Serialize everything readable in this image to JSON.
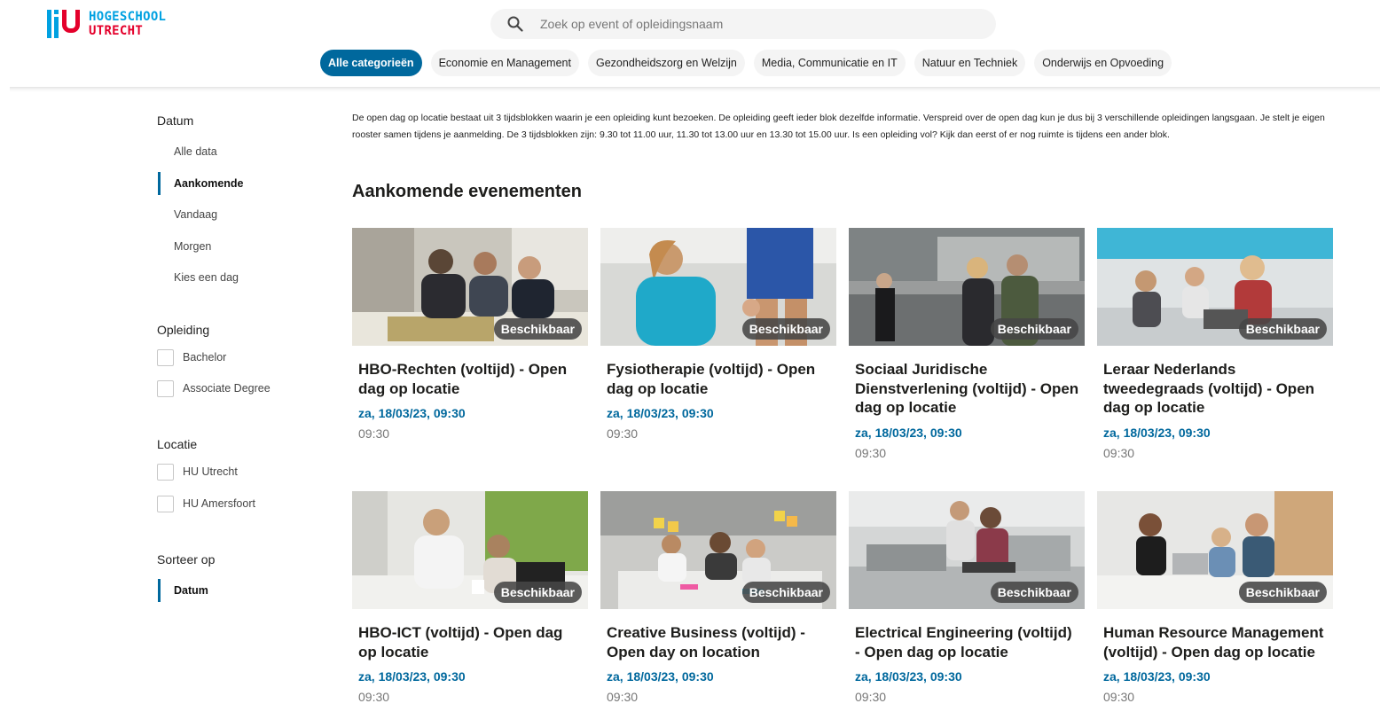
{
  "logo": {
    "line1": "HOGESCHOOL",
    "line2": "UTRECHT"
  },
  "search": {
    "placeholder": "Zoek op event of opleidingsnaam",
    "icon": "search-icon"
  },
  "categories": [
    {
      "label": "Alle categorieën",
      "active": true
    },
    {
      "label": "Economie en Management"
    },
    {
      "label": "Gezondheidszorg en Welzijn"
    },
    {
      "label": "Media, Communicatie en IT"
    },
    {
      "label": "Natuur en Techniek"
    },
    {
      "label": "Onderwijs en Opvoeding"
    }
  ],
  "sidebar": {
    "datum": {
      "title": "Datum",
      "options": [
        "Alle data",
        "Aankomende",
        "Vandaag",
        "Morgen",
        "Kies een dag"
      ],
      "selected": "Aankomende"
    },
    "opleiding": {
      "title": "Opleiding",
      "options": [
        "Bachelor",
        "Associate Degree"
      ]
    },
    "locatie": {
      "title": "Locatie",
      "options": [
        "HU Utrecht",
        "HU Amersfoort"
      ]
    },
    "sorteer": {
      "title": "Sorteer op",
      "selected": "Datum"
    }
  },
  "intro": "De open dag op locatie bestaat uit 3 tijdsblokken waarin je een opleiding kunt bezoeken. De opleiding geeft ieder blok dezelfde informatie. Verspreid over de open dag kun je dus bij 3 verschillende opleidingen langsgaan. Je stelt je eigen rooster samen tijdens je aanmelding. De 3 tijdsblokken zijn: 9.30 tot 11.00 uur, 11.30 tot 13.00 uur en 13.30 tot 15.00 uur. Is een opleiding vol? Kijk dan eerst of er nog ruimte is tijdens een ander blok.",
  "heading": "Aankomende evenementen",
  "events": [
    {
      "title": "HBO-Rechten (voltijd) - Open dag op locatie",
      "date": "za, 18/03/23, 09:30",
      "time": "09:30",
      "badge": "Beschikbaar"
    },
    {
      "title": "Fysiotherapie (voltijd) - Open dag op locatie",
      "date": "za, 18/03/23, 09:30",
      "time": "09:30",
      "badge": "Beschikbaar"
    },
    {
      "title": "Sociaal Juridische Dienstverlening (voltijd) - Open dag op locatie",
      "date": "za, 18/03/23, 09:30",
      "time": "09:30",
      "badge": "Beschikbaar"
    },
    {
      "title": "Leraar Nederlands tweedegraads (voltijd) - Open dag op locatie",
      "date": "za, 18/03/23, 09:30",
      "time": "09:30",
      "badge": "Beschikbaar"
    },
    {
      "title": "HBO-ICT (voltijd) - Open dag op locatie",
      "date": "za, 18/03/23, 09:30",
      "time": "09:30",
      "badge": "Beschikbaar"
    },
    {
      "title": "Creative Business (voltijd) - Open day on location",
      "date": "za, 18/03/23, 09:30",
      "time": "09:30",
      "badge": "Beschikbaar"
    },
    {
      "title": "Electrical Engineering (voltijd) - Open dag op locatie",
      "date": "za, 18/03/23, 09:30",
      "time": "09:30",
      "badge": "Beschikbaar"
    },
    {
      "title": "Human Resource Management (voltijd) - Open dag op locatie",
      "date": "za, 18/03/23, 09:30",
      "time": "09:30",
      "badge": "Beschikbaar"
    }
  ],
  "colors": {
    "primary": "#00689d",
    "logo_blue": "#00a1e1",
    "logo_red": "#e4002b"
  }
}
